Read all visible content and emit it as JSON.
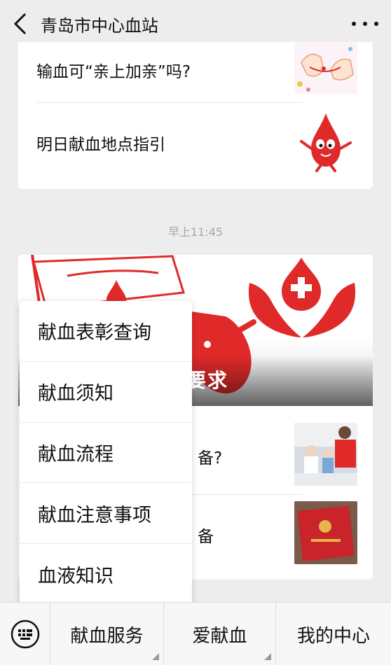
{
  "header": {
    "title": "青岛市中心血站"
  },
  "feed": {
    "card1": {
      "items": [
        {
          "title": "输血可“亲上加亲”吗?"
        },
        {
          "title": "明日献血地点指引"
        }
      ]
    },
    "timestamp": "早上11:45",
    "card2": {
      "banner_caption": "要求",
      "items": [
        {
          "title_tail": "备?"
        },
        {
          "title_tail": "备"
        }
      ]
    }
  },
  "popup_menu": {
    "items": [
      {
        "label": "献血表彰查询"
      },
      {
        "label": "献血须知"
      },
      {
        "label": "献血流程"
      },
      {
        "label": "献血注意事项"
      },
      {
        "label": "血液知识"
      }
    ]
  },
  "bottom_bar": {
    "tabs": [
      {
        "label": "献血服务"
      },
      {
        "label": "爱献血"
      },
      {
        "label": "我的中心"
      }
    ]
  },
  "colors": {
    "accent_red": "#e02a2a",
    "background": "#ededed"
  }
}
